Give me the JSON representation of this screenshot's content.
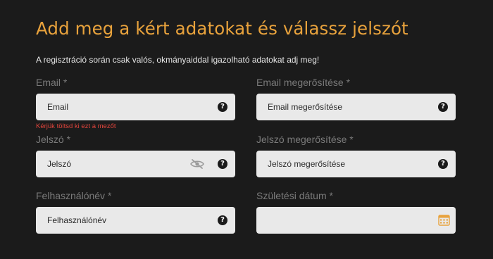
{
  "page": {
    "title": "Add meg a kért adatokat és válassz jelszót",
    "subtitle": "A regisztráció során csak valós, okmányaiddal igazolható adatokat adj meg!"
  },
  "colors": {
    "background": "#1b1b1b",
    "accent": "#e8a23c",
    "error": "#e2453c",
    "input_bg": "#e9e9e9",
    "label": "#7a7a7a"
  },
  "fields": {
    "email": {
      "label": "Email *",
      "placeholder": "Email",
      "icon": "help-icon",
      "error": "Kérjük töltsd ki ezt a mezőt"
    },
    "email_confirm": {
      "label": "Email megerősítése *",
      "placeholder": "Email megerősítése",
      "icon": "help-icon"
    },
    "password": {
      "label": "Jelszó *",
      "placeholder": "Jelszó",
      "icons": [
        "eye-slash-icon",
        "help-icon"
      ]
    },
    "password_confirm": {
      "label": "Jelszó megerősítése *",
      "placeholder": "Jelszó megerősítése",
      "icon": "help-icon"
    },
    "username": {
      "label": "Felhasználónév *",
      "placeholder": "Felhasználónév",
      "icon": "help-icon"
    },
    "birth_date": {
      "label": "Születési dátum *",
      "placeholder": "",
      "icon": "calendar-icon"
    }
  },
  "icons": {
    "help_glyph": "?"
  }
}
